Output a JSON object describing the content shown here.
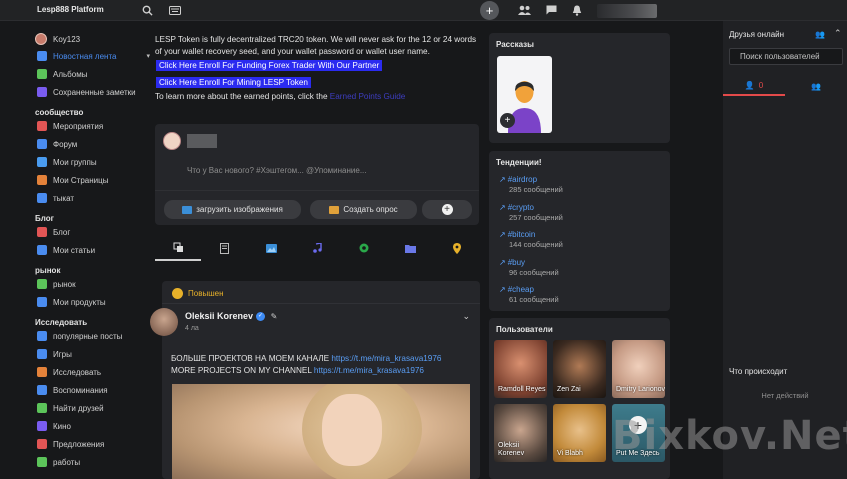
{
  "topbar": {
    "brand": "Lesp888 Platform"
  },
  "sidebar": {
    "username": "Koy123",
    "items_main": [
      {
        "label": "Новостная лента",
        "icon": "home-icon",
        "color": "#4a8cf0",
        "active": true
      },
      {
        "label": "Альбомы",
        "icon": "album-icon",
        "color": "#5cc45a"
      },
      {
        "label": "Сохраненные заметки",
        "icon": "bookmark-icon",
        "color": "#7a5cf0"
      }
    ],
    "section_community": "сообщество",
    "items_community": [
      {
        "label": "Мероприятия",
        "icon": "calendar-icon",
        "color": "#e25555"
      },
      {
        "label": "Форум",
        "icon": "forum-icon",
        "color": "#4a8cf0"
      },
      {
        "label": "Мои группы",
        "icon": "groups-icon",
        "color": "#4a9cf0"
      },
      {
        "label": "Мои Страницы",
        "icon": "flag-icon",
        "color": "#e4823a"
      },
      {
        "label": "тыкат",
        "icon": "poke-icon",
        "color": "#4a8cf0"
      }
    ],
    "section_blog": "Блог",
    "items_blog": [
      {
        "label": "Блог",
        "icon": "blog-icon",
        "color": "#e25555"
      },
      {
        "label": "Мои статьи",
        "icon": "articles-icon",
        "color": "#4a8cf0"
      }
    ],
    "section_market": "рынок",
    "items_market": [
      {
        "label": "рынок",
        "icon": "market-icon",
        "color": "#5cc45a"
      },
      {
        "label": "Мои продукты",
        "icon": "products-icon",
        "color": "#4a8cf0"
      }
    ],
    "section_explore": "Исследовать",
    "items_explore": [
      {
        "label": "популярные посты",
        "icon": "popular-icon",
        "color": "#4a8cf0"
      },
      {
        "label": "Игры",
        "icon": "games-icon",
        "color": "#4a8cf0"
      },
      {
        "label": "Исследовать",
        "icon": "explore-icon",
        "color": "#e4823a"
      },
      {
        "label": "Воспоминания",
        "icon": "memories-icon",
        "color": "#4a8cf0"
      },
      {
        "label": "Найти друзей",
        "icon": "find-friends-icon",
        "color": "#5cc45a"
      },
      {
        "label": "Кино",
        "icon": "movie-icon",
        "color": "#7a5cf0"
      },
      {
        "label": "Предложения",
        "icon": "offers-icon",
        "color": "#e25555"
      },
      {
        "label": "работы",
        "icon": "jobs-icon",
        "color": "#5cc45a"
      }
    ]
  },
  "notice": {
    "text": "LESP Token is fully decentralized TRC20 token. We will never ask for the 12 or 24 words of your wallet recovery seed, and your wallet password or wallet user name.",
    "button1": "Click Here Enroll For Funding Forex Trader With Our Partner",
    "button2": "Click Here Enroll For Mining LESP Token",
    "learn_prefix": "To learn more about the earned points, click the",
    "learn_link": "Earned Points Guide"
  },
  "composer": {
    "placeholder": "Что у Вас нового? #Хэштегом... @Упоминание...",
    "upload_label": "загрузить изображения",
    "poll_label": "Создать опрос"
  },
  "post": {
    "pinned_label": "Повышен",
    "author": "Oleksii Korenev",
    "time": "4 ла",
    "line1_text": "БОЛЬШЕ ПРОЕКТОВ НА МОЕМ КАНАЛЕ",
    "line1_link": "https://t.me/mira_krasava1976",
    "line2_text": "MORE PROJECTS ON MY CHANNEL",
    "line2_link": "https://t.me/mira_krasava1976"
  },
  "stories": {
    "title": "Рассказы"
  },
  "trends": {
    "title": "Тенденции!",
    "items": [
      {
        "tag": "#airdrop",
        "count": "285 сообщений"
      },
      {
        "tag": "#crypto",
        "count": "257 сообщений"
      },
      {
        "tag": "#bitcoin",
        "count": "144 сообщений"
      },
      {
        "tag": "#buy",
        "count": "96 сообщений"
      },
      {
        "tag": "#cheap",
        "count": "61 сообщений"
      }
    ]
  },
  "users": {
    "title": "Пользователи",
    "items": [
      {
        "name": "Ramdoll Reyes"
      },
      {
        "name": "Zen Zai"
      },
      {
        "name": "Dmitry Larionov"
      },
      {
        "name": "Oleksii Korenev"
      },
      {
        "name": "Vi Blabh"
      },
      {
        "name": "Put Me Здесь"
      }
    ]
  },
  "rightbar": {
    "online_title": "Друзья онлайн",
    "search_placeholder": "Поиск пользователей",
    "tab_count": "0",
    "whats_happening": "Что происходит",
    "no_activity": "Нет действий"
  },
  "watermark": "Bixkov.Net"
}
